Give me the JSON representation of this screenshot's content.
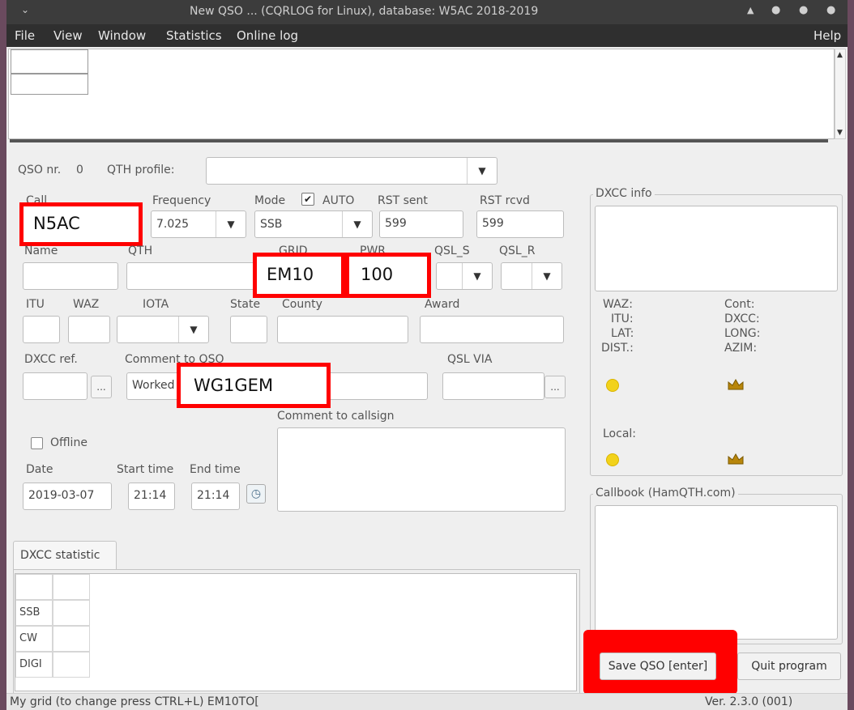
{
  "window": {
    "title": "New QSO ... (CQRLOG for Linux), database: W5AC 2018-2019",
    "menu": [
      "File",
      "View",
      "Window",
      "Statistics",
      "Online log"
    ],
    "help": "Help"
  },
  "qso": {
    "nr_label": "QSO nr.",
    "nr_value": "0",
    "qth_profile_label": "QTH profile:",
    "qth_profile_value": ""
  },
  "fields": {
    "call_label": "Call",
    "call_value": "N5AC",
    "frequency_label": "Frequency",
    "frequency_value": "7.025",
    "mode_label": "Mode",
    "mode_value": "SSB",
    "auto_label": "AUTO",
    "rst_sent_label": "RST sent",
    "rst_sent_value": "599",
    "rst_rcvd_label": "RST rcvd",
    "rst_rcvd_value": "599",
    "name_label": "Name",
    "qth_label": "QTH",
    "grid_label": "GRID",
    "grid_value": "EM10",
    "pwr_label": "PWR",
    "pwr_value": "100",
    "qsl_s_label": "QSL_S",
    "qsl_r_label": "QSL_R",
    "itu_label": "ITU",
    "waz_label": "WAZ",
    "iota_label": "IOTA",
    "state_label": "State",
    "county_label": "County",
    "award_label": "Award",
    "dxcc_ref_label": "DXCC ref.",
    "comment_qso_label": "Comment to QSO",
    "comment_qso_value": "Worked by",
    "comment_qso_overlay": "WG1GEM",
    "qsl_via_label": "QSL VIA",
    "comment_callsign_label": "Comment to callsign",
    "offline_label": "Offline",
    "date_label": "Date",
    "date_value": "2019-03-07",
    "start_label": "Start time",
    "start_value": "21:14",
    "end_label": "End time",
    "end_value": "21:14",
    "dots": "..."
  },
  "dxcc_info": {
    "title": "DXCC info",
    "waz": "WAZ:",
    "itu": "ITU:",
    "lat": "LAT:",
    "dist": "DIST.:",
    "cont": "Cont:",
    "dxcc": "DXCC:",
    "long": "LONG:",
    "azim": "AZIM:",
    "local": "Local:"
  },
  "callbook": {
    "title": "Callbook (HamQTH.com)"
  },
  "dxcc_stat": {
    "tab": "DXCC statistic",
    "rows": [
      "SSB",
      "CW",
      "DIGI"
    ]
  },
  "buttons": {
    "save": "Save QSO [enter]",
    "quit": "Quit program"
  },
  "status": {
    "left": "My grid (to change press CTRL+L) EM10TO[",
    "right": "Ver. 2.3.0 (001)"
  }
}
